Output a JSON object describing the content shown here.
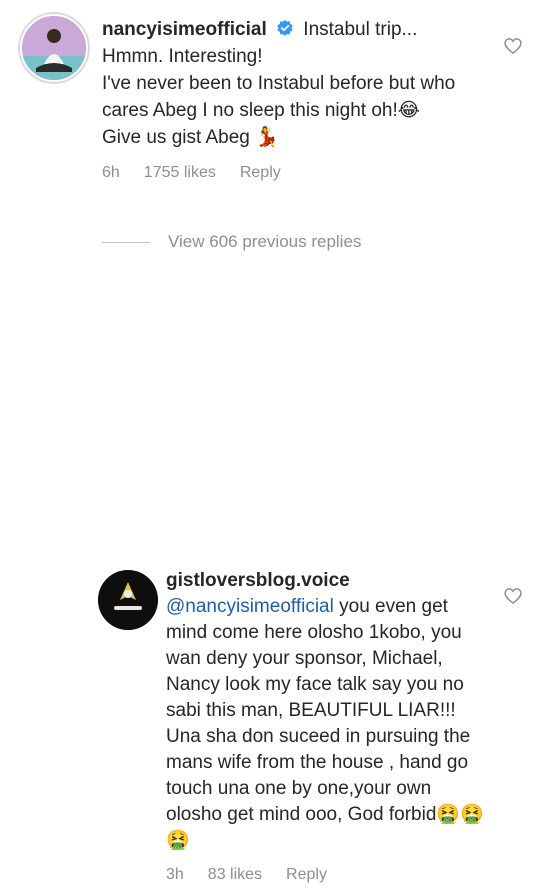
{
  "first_comment": {
    "username": "nancyisimeofficial",
    "caption_snippet": "Instabul trip...",
    "lines": [
      "Hmmn. Interesting!",
      "I've never been to Instabul before but who cares Abeg I no sleep this night oh!😂",
      "Give us gist Abeg 💃"
    ],
    "time": "6h",
    "likes": "1755 likes",
    "reply_label": "Reply"
  },
  "view_replies": "View 606 previous replies",
  "second_comment": {
    "username": "gistloversblog.voice",
    "mention": "@nancyisimeofficial",
    "text": "you even get mind come here olosho 1kobo, you wan deny your sponsor, Michael, Nancy look my face talk say you no sabi this man, BEAUTIFUL LIAR!!! Una sha don suceed in pursuing the mans wife from the house , hand go touch una one by one,your own olosho get mind ooo, God forbid🤮🤮🤮",
    "time": "3h",
    "likes": "83 likes",
    "reply_label": "Reply"
  },
  "icons": {
    "verified": "verified-badge-icon",
    "heart": "heart-outline-icon"
  },
  "colors": {
    "verified_blue": "#3897f0",
    "mention_blue": "#1d5f9e",
    "meta_gray": "#8e8e8e"
  }
}
